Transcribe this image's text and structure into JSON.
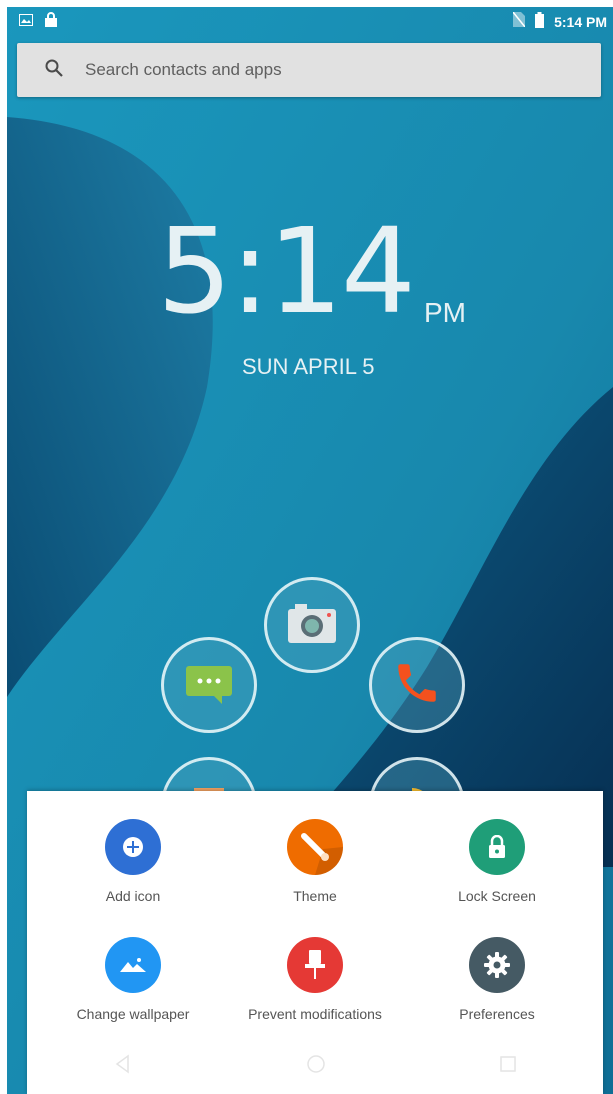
{
  "status_bar": {
    "time": "5:14 PM",
    "icons": [
      "image-notification-icon",
      "lock-notification-icon",
      "no-sim-icon",
      "battery-icon"
    ]
  },
  "search": {
    "placeholder": "Search contacts and apps"
  },
  "clock": {
    "time": "5:14",
    "ampm": "PM",
    "date": "SUN APRIL 5"
  },
  "dock": {
    "apps": [
      "messages-icon",
      "camera-icon",
      "phone-icon",
      "app-icon-partial-left",
      "app-icon-partial-right"
    ]
  },
  "menu": {
    "items": [
      {
        "label": "Add icon",
        "icon": "add-icon",
        "color": "#2e6fd4"
      },
      {
        "label": "Theme",
        "icon": "theme-brush-icon",
        "color": "#ef6c00"
      },
      {
        "label": "Lock Screen",
        "icon": "lock-icon",
        "color": "#1f9e78"
      },
      {
        "label": "Change wallpaper",
        "icon": "wallpaper-icon",
        "color": "#2196f3"
      },
      {
        "label": "Prevent modifications",
        "icon": "pin-icon",
        "color": "#e53935"
      },
      {
        "label": "Preferences",
        "icon": "gear-icon",
        "color": "#455a64"
      }
    ]
  },
  "nav": {
    "buttons": [
      "back-icon",
      "home-icon",
      "recents-icon"
    ]
  }
}
